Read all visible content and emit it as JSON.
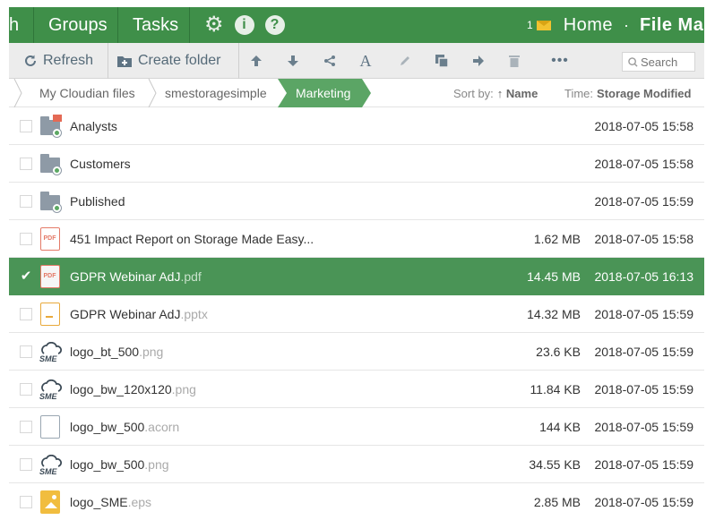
{
  "nav": {
    "first_fragment": "h",
    "groups": "Groups",
    "tasks": "Tasks",
    "settings_icon": "gear-icon",
    "info_icon": "info-icon",
    "help_icon": "help-icon",
    "info_glyph": "i",
    "help_glyph": "?",
    "notification_count": "1",
    "home": "Home",
    "separator": "·",
    "file_manager": "File Ma"
  },
  "toolbar": {
    "refresh": "Refresh",
    "create_folder": "Create folder",
    "more": "•••",
    "search_placeholder": "Search"
  },
  "breadcrumb": {
    "items": [
      "My Cloudian files",
      "smestoragesimple"
    ],
    "active": "Marketing",
    "sort_label": "Sort by:",
    "sort_value": "↑ Name",
    "time_label": "Time:",
    "time_value": "Storage Modified"
  },
  "files": [
    {
      "type": "folder",
      "badge": "pdf",
      "name": "Analysts",
      "ext": "",
      "size": "",
      "date": "2018-07-05 15:58",
      "selected": false
    },
    {
      "type": "folder",
      "badge": "",
      "name": "Customers",
      "ext": "",
      "size": "",
      "date": "2018-07-05 15:58",
      "selected": false
    },
    {
      "type": "folder",
      "badge": "",
      "name": "Published",
      "ext": "",
      "size": "",
      "date": "2018-07-05 15:59",
      "selected": false
    },
    {
      "type": "pdf",
      "name": "451 Impact Report on Storage Made Easy...",
      "ext": "",
      "size": "1.62 MB",
      "date": "2018-07-05 15:58",
      "selected": false
    },
    {
      "type": "pdf",
      "name": "GDPR Webinar AdJ",
      "ext": ".pdf",
      "size": "14.45 MB",
      "date": "2018-07-05 16:13",
      "selected": true
    },
    {
      "type": "ppt",
      "name": "GDPR Webinar AdJ",
      "ext": ".pptx",
      "size": "14.32 MB",
      "date": "2018-07-05 15:59",
      "selected": false
    },
    {
      "type": "sme",
      "name": "logo_bt_500",
      "ext": ".png",
      "size": "23.6 KB",
      "date": "2018-07-05 15:59",
      "selected": false
    },
    {
      "type": "sme",
      "name": "logo_bw_120x120",
      "ext": ".png",
      "size": "11.84 KB",
      "date": "2018-07-05 15:59",
      "selected": false
    },
    {
      "type": "blank",
      "name": "logo_bw_500",
      "ext": ".acorn",
      "size": "144 KB",
      "date": "2018-07-05 15:59",
      "selected": false
    },
    {
      "type": "sme",
      "name": "logo_bw_500",
      "ext": ".png",
      "size": "34.55 KB",
      "date": "2018-07-05 15:59",
      "selected": false
    },
    {
      "type": "img",
      "name": "logo_SME",
      "ext": ".eps",
      "size": "2.85 MB",
      "date": "2018-07-05 15:59",
      "selected": false
    }
  ],
  "labels": {
    "pdf": "PDF",
    "sme": "SME",
    "check": "✔"
  },
  "colors": {
    "accent": "#3f8f49",
    "selected_row": "#4a9456"
  }
}
